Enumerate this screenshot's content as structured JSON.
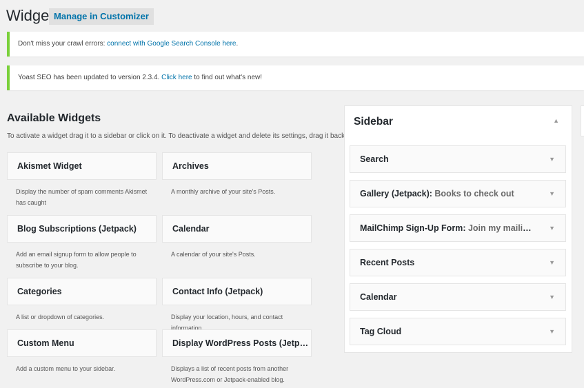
{
  "header": {
    "title": "Widgets",
    "customizer_button": "Manage in Customizer"
  },
  "notices": [
    {
      "text": "Don't miss your crawl errors: ",
      "link": "connect with Google Search Console here",
      "suffix": "."
    },
    {
      "text": "Yoast SEO has been updated to version 2.3.4. ",
      "link": "Click here",
      "suffix": " to find out what's new!"
    }
  ],
  "available": {
    "title": "Available Widgets",
    "description": "To activate a widget drag it to a sidebar or click on it. To deactivate a widget and delete its settings, drag it back.",
    "widgets": [
      {
        "name": "Akismet Widget",
        "desc": "Display the number of spam comments Akismet has caught"
      },
      {
        "name": "Archives",
        "desc": "A monthly archive of your site's Posts."
      },
      {
        "name": "Blog Subscriptions (Jetpack)",
        "desc": "Add an email signup form to allow people to subscribe to your blog."
      },
      {
        "name": "Calendar",
        "desc": "A calendar of your site's Posts."
      },
      {
        "name": "Categories",
        "desc": "A list or dropdown of categories."
      },
      {
        "name": "Contact Info (Jetpack)",
        "desc": "Display your location, hours, and contact information."
      },
      {
        "name": "Custom Menu",
        "desc": "Add a custom menu to your sidebar."
      },
      {
        "name": "Display WordPress Posts (Jetpack)",
        "desc": "Displays a list of recent posts from another WordPress.com or Jetpack-enabled blog."
      }
    ]
  },
  "sidebar": {
    "title": "Sidebar",
    "toggle_icon": "▲",
    "widgets": [
      {
        "name": "Search",
        "title": ""
      },
      {
        "name": "Gallery (Jetpack)",
        "title": "Books to check out"
      },
      {
        "name": "MailChimp Sign-Up Form",
        "title": "Join my mailing ..."
      },
      {
        "name": "Recent Posts",
        "title": ""
      },
      {
        "name": "Calendar",
        "title": ""
      },
      {
        "name": "Tag Cloud",
        "title": ""
      }
    ],
    "arrow_icon": "▼"
  },
  "colors": {
    "accent": "#0073aa",
    "notice_border": "#7ad03a",
    "background": "#f1f1f1"
  }
}
